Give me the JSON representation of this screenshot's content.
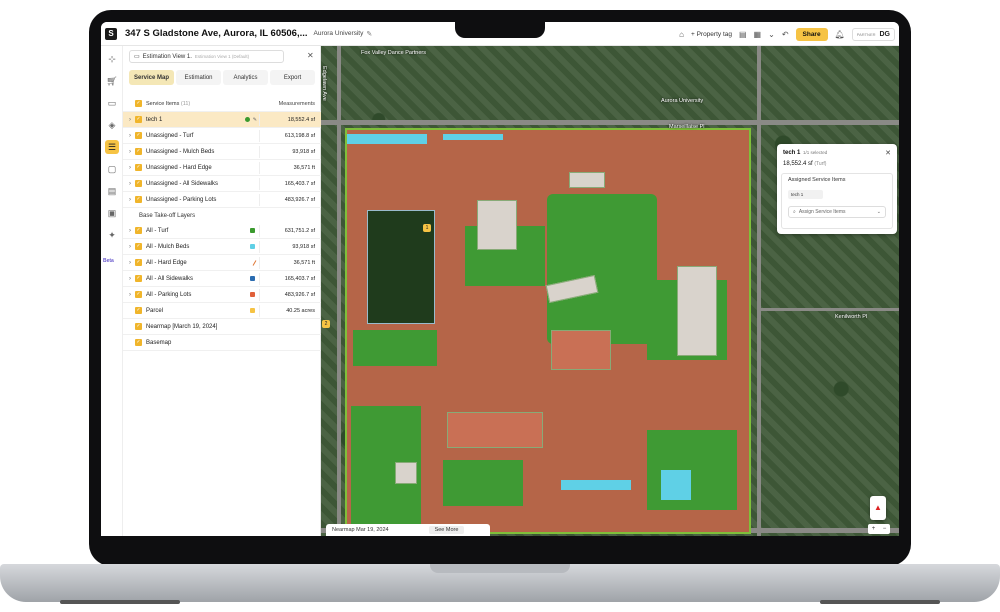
{
  "topbar": {
    "logo": "S",
    "address": "347 S Gladstone Ave, Aurora, IL 60506,...",
    "site_name": "Aurora University",
    "property_tag": "+ Property tag",
    "share_label": "Share",
    "account_initials": "DG",
    "account_org": "PARTNER"
  },
  "panel": {
    "view_label": "Estimation View 1.",
    "view_sub": "Estimation View 1 (Default)",
    "tabs": [
      "Service Map",
      "Estimation",
      "Analytics",
      "Export"
    ],
    "active_tab": "Service Map",
    "header": {
      "service_items": "Service Items",
      "service_count": "(11)",
      "measurements": "Measurements"
    },
    "service_items": [
      {
        "name": "tech 1",
        "value": "18,552.4 sf",
        "highlight": true
      },
      {
        "name": "Unassigned - Turf",
        "value": "613,198.8 sf"
      },
      {
        "name": "Unassigned - Mulch Beds",
        "value": "93,918 sf"
      },
      {
        "name": "Unassigned - Hard Edge",
        "value": "36,571 ft"
      },
      {
        "name": "Unassigned - All Sidewalks",
        "value": "165,403.7 sf"
      },
      {
        "name": "Unassigned - Parking Lots",
        "value": "483,926.7 sf"
      }
    ],
    "base_section": "Base Take-off Layers",
    "base_layers": [
      {
        "name": "All - Turf",
        "value": "631,751.2 sf",
        "color": "#3a9a2e"
      },
      {
        "name": "All - Mulch Beds",
        "value": "93,918 sf",
        "color": "#5fd0e6"
      },
      {
        "name": "All - Hard Edge",
        "value": "36,571 ft",
        "color": "#e07a3a"
      },
      {
        "name": "All - All Sidewalks",
        "value": "165,403.7 sf",
        "color": "#2b6cb0"
      },
      {
        "name": "All - Parking Lots",
        "value": "483,926.7 sf",
        "color": "#e0603a"
      },
      {
        "name": "Parcel",
        "value": "40.25 acres",
        "color": "#f6c344"
      }
    ],
    "extra_layers": [
      {
        "name": "Nearmap [March 19, 2024]"
      },
      {
        "name": "Basemap"
      }
    ]
  },
  "map": {
    "labels": {
      "fox_valley": "Fox Valley Dance Partners",
      "aurora_univ": "Aurora University",
      "kenilworth": "Kenilworth Pl",
      "marseillaise": "Marseillaise Pl",
      "edgelawn": "Edgelawn Ave"
    },
    "badge_field": "1",
    "badge_left": "2",
    "nearmap_date": "Nearmap Mar 19, 2024",
    "see_more": "See More"
  },
  "popover": {
    "title": "tech 1",
    "selected": "1/1 selected",
    "measurement": "18,552.4 sf",
    "unit_note": "(Turf)",
    "assigned_label": "Assigned Service Items",
    "chip": "tech 1",
    "assign_placeholder": "Assign Service Items"
  },
  "colors": {
    "accent": "#f6c344",
    "turf": "#3f9a34",
    "mulch": "#5fd0e6",
    "hardscape": "#b56548"
  }
}
